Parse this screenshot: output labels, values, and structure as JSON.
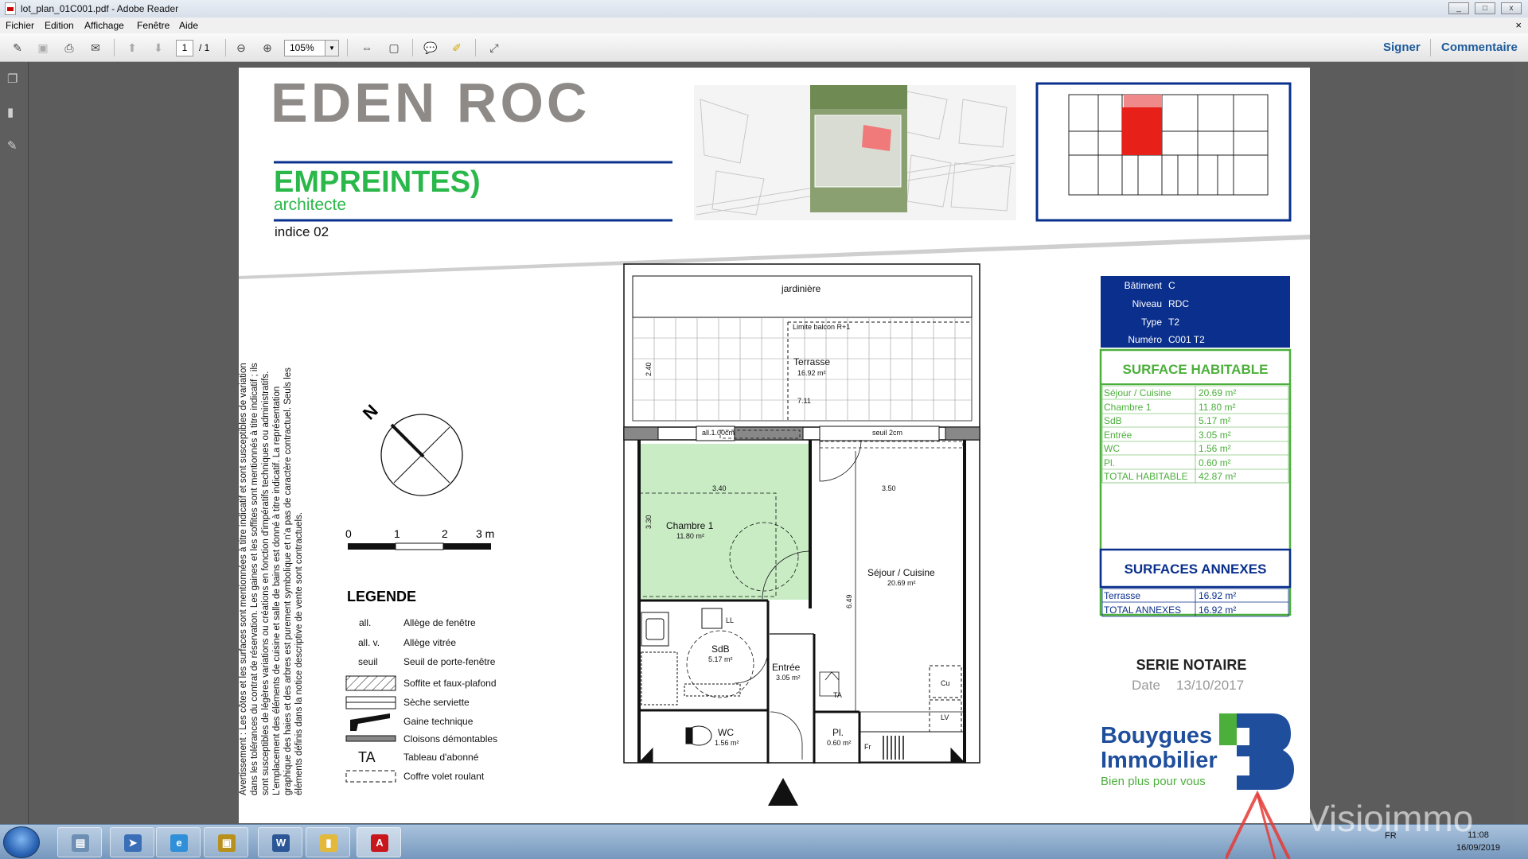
{
  "window": {
    "title": "lot_plan_01C001.pdf - Adobe Reader",
    "min": "▭",
    "max": "▭",
    "close": "✕"
  },
  "menu": {
    "items": [
      "Fichier",
      "Edition",
      "Affichage",
      "Fenêtre",
      "Aide"
    ],
    "close": "×"
  },
  "toolbar": {
    "page_current": "1",
    "page_total": "/ 1",
    "zoom": "105%",
    "sign": "Signer",
    "comment": "Commentaire"
  },
  "doc": {
    "title": "EDEN ROC",
    "architect_name": "EMPREINTES)",
    "architect_sub": "architecte",
    "indice": "indice 02",
    "warning": "Avertissement : Les côtes et les surfaces sont mentionnées à titre indicatif et sont susceptibles de variation dans les tolérances du contrat de réservation. Les gaines et les soffites sont mentionnés à titre indicatif ; ils sont susceptibles de légères variations ou créations en fonction d'impératifs techniques ou administratifs. L'emplacement des éléments de cuisine et salle de bains est donné à titre indicatif. La représentation graphique des haies et des arbres est purement symbolique et n'a pas de caractère contractuel. Seuls les éléments définis dans la notice descriptive de vente sont contractuels.",
    "scale": {
      "labels": [
        "0",
        "1",
        "2",
        "3 m"
      ]
    },
    "legend": {
      "title": "LEGENDE",
      "items": [
        {
          "sym": "all.",
          "label": "Allège de fenêtre"
        },
        {
          "sym": "all. v.",
          "label": "Allège vitrée"
        },
        {
          "sym": "seuil",
          "label": "Seuil de porte-fenêtre"
        },
        {
          "sym": "",
          "label": "Soffite et faux-plafond"
        },
        {
          "sym": "",
          "label": "Sèche serviette"
        },
        {
          "sym": "",
          "label": "Gaine technique"
        },
        {
          "sym": "",
          "label": "Cloisons démontables"
        },
        {
          "sym": "TA",
          "label": "Tableau d'abonné"
        },
        {
          "sym": "",
          "label": "Coffre volet roulant"
        }
      ]
    },
    "plan": {
      "jardiniere": "jardinière",
      "balcon": "Limite balcon R+1",
      "terrasse": "Terrasse",
      "terrasse_area": "16.92 m²",
      "dim_240": "2.40",
      "dim_711": "7.11",
      "dim_340": "3.40",
      "dim_330": "3.30",
      "dim_350": "3.50",
      "dim_649": "6.49",
      "all": "all.1.00cm",
      "seuil": "seuil 2cm",
      "chambre": "Chambre 1",
      "chambre_area": "11.80 m²",
      "sejour": "Séjour / Cuisine",
      "sejour_area": "20.69 m²",
      "sdb": "SdB",
      "sdb_area": "5.17 m²",
      "entree": "Entrée",
      "entree_area": "3.05 m²",
      "wc": "WC",
      "wc_area": "1.56 m²",
      "pl": "Pl.",
      "pl_area": "0.60 m²",
      "ll": "LL",
      "ta": "TA",
      "cu": "Cu",
      "lv": "LV",
      "fr": "Fr"
    },
    "info": {
      "rows": [
        {
          "k": "Bâtiment",
          "v": "C"
        },
        {
          "k": "Niveau",
          "v": "RDC"
        },
        {
          "k": "Type",
          "v": "T2"
        },
        {
          "k": "Numéro",
          "v": "C001 T2"
        }
      ],
      "hab_title": "SURFACE HABITABLE",
      "hab": [
        {
          "k": "Séjour / Cuisine",
          "v": "20.69 m²"
        },
        {
          "k": "Chambre 1",
          "v": "11.80 m²"
        },
        {
          "k": "SdB",
          "v": "5.17 m²"
        },
        {
          "k": "Entrée",
          "v": "3.05 m²"
        },
        {
          "k": "WC",
          "v": "1.56 m²"
        },
        {
          "k": "Pl.",
          "v": "0.60 m²"
        },
        {
          "k": "TOTAL HABITABLE",
          "v": "42.87 m²"
        }
      ],
      "ann_title": "SURFACES ANNEXES",
      "ann": [
        {
          "k": "Terrasse",
          "v": "16.92 m²"
        },
        {
          "k": "TOTAL ANNEXES",
          "v": "16.92 m²"
        }
      ]
    },
    "serie": "SERIE NOTAIRE",
    "date_label": "Date",
    "date_value": "13/10/2017",
    "brand1": "Bouygues",
    "brand2": "Immobilier",
    "brand_tag": "Bien plus pour vous"
  },
  "taskbar": {
    "lang": "FR",
    "time": "11:08",
    "date": "16/09/2019",
    "watermark": "Visioimmo"
  },
  "colors": {
    "navy": "#0a2f8c",
    "green": "#4caf3c",
    "brand_blue": "#1f4e9c",
    "red": "#e8201a"
  }
}
